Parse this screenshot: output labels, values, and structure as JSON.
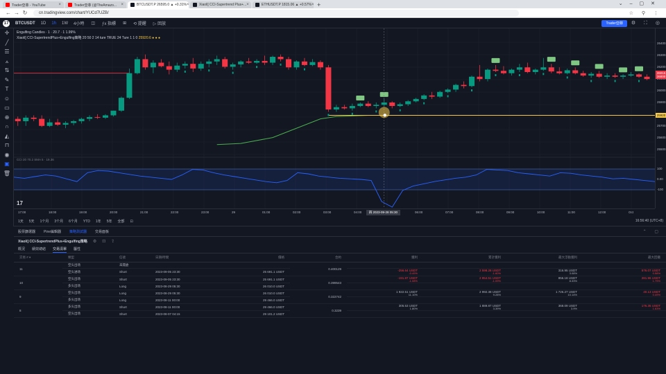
{
  "browser": {
    "tabs": [
      {
        "title": "Trader亞菲 - YouTube",
        "icon_color": "#ff0000",
        "active": false
      },
      {
        "title": "Trader亞菲 (@TheAmazo...",
        "icon_color": "#ff0000",
        "active": false
      },
      {
        "title": "BTCUSDT.P 26595.0 ▲ +0.31%",
        "icon_color": "#131722",
        "active": true
      },
      {
        "title": "Xiaoli] CCI-Supertrend Plus+...",
        "icon_color": "#131722",
        "active": false
      },
      {
        "title": "ETHUSDT.P 1815.06 ▲ +0.57%",
        "icon_color": "#131722",
        "active": false
      }
    ],
    "url": "cn.tradingview.com/chart/YUCd7UZB/"
  },
  "toolbar": {
    "logo": "17",
    "symbol": "BTCUSDT",
    "timeframes": [
      "1D",
      "1h",
      "1W",
      "4小時"
    ],
    "selected_timeframe": "1h",
    "items": [
      "◫",
      "ƒx 指標",
      "⊞",
      "⟲ 提醒",
      "▷ 回放"
    ],
    "user_button": "Trader亞菲",
    "right_icons": "⚙ ⛶ ◎"
  },
  "legend": {
    "line1": "Engulfing Candles · 1 · 20.7 · 1 1.99%",
    "line2_name": "Xiaoli] CCI-SupertrendPlus+Engulfing策略 20 50 2 14 ture TRUE 24 Ture 1 1 0",
    "line2_value": "25920.6 ● ● ●"
  },
  "price_scale": {
    "labels": [
      "26400.0",
      "26300.0",
      "26200.0",
      "26100.0",
      "26000.0",
      "25900.0",
      "25800.0",
      "25700.0",
      "25600.0",
      "25500.0"
    ],
    "tags": [
      {
        "text": "26015",
        "color": "#f23645"
      },
      {
        "text": "26000",
        "color": "#f23645"
      },
      {
        "text": "25920",
        "color": "#f7c948"
      }
    ],
    "ind_labels": [
      "100",
      "0.00",
      "-100"
    ]
  },
  "indicator_legend": "CCI 20 70.2 SMA 5 · 19.36",
  "watermark": "17",
  "time_axis": {
    "labels": [
      "17:00",
      "18:00",
      "19:00",
      "20:00",
      "21:00",
      "22:00",
      "23:00",
      "29",
      "01:00",
      "02:00",
      "03:00",
      "04:00",
      "05:00",
      "06:00",
      "07:00",
      "08:00",
      "09:00",
      "10:00",
      "11:00",
      "12:00",
      "Oct"
    ],
    "cursor_tag": "四 2023-09-28 05:30"
  },
  "range_bar": {
    "items": [
      "1天",
      "5天",
      "1个月",
      "3个月",
      "6个月",
      "YTD",
      "1年",
      "5年",
      "全部",
      "⊡"
    ],
    "clock": "16:56:40 (UTC+8)"
  },
  "tester": {
    "tabs": [
      "股票篩選器",
      "Pine編輯器",
      "策略測試器",
      "交易面板"
    ],
    "selected_tab": "策略測試器",
    "strategy_name": "Xiaoli] CCI-SupertrendPlus+Engulfing策略",
    "strategy_icons": [
      "⚙",
      "⊡",
      "⇪"
    ],
    "subtabs": [
      "概況",
      "績效總結",
      "交易清單",
      "屬性"
    ],
    "selected_subtab": "交易清單",
    "columns": [
      "交易 # ▾",
      "類型",
      "信號",
      "日期/時間",
      "價格",
      "合約",
      "獲利",
      "累計獲利",
      "最大浮動獲利",
      "最大回撤"
    ],
    "trades": [
      {
        "num": "11",
        "contracts": "0.400129",
        "rows": [
          {
            "type": "空头出场",
            "signal": "未開倉",
            "date": "",
            "price": "",
            "profit": "",
            "profit_pct": "",
            "cum": "",
            "cum_pct": "",
            "runup": "",
            "runup_pct": "",
            "dd": "",
            "dd_pct": ""
          },
          {
            "type": "空头进场",
            "signal": "Short",
            "date": "2023-09-05 23:30",
            "price": "25 691.1 USDT",
            "profit": "-256.64 USDT",
            "profit_pct": "-0.49%",
            "cum": "2 598.28 USDT",
            "cum_pct": "-1.60%",
            "runup": "316.95 USDT",
            "runup_pct": "3.08%",
            "dd": "576.07 USDT",
            "dd_pct": "0.58%"
          }
        ]
      },
      {
        "num": "10",
        "contracts": "0.399543",
        "rows": [
          {
            "type": "空头出场",
            "signal": "Short",
            "date": "2023-09-05 23:30",
            "price": "25 691.1 USDT",
            "profit": "-191.87 USDT",
            "profit_pct": "-1.08%",
            "cum": "2 854.51 USDT",
            "cum_pct": "-1.09%",
            "runup": "856.18 USDT",
            "runup_pct": "8.33%",
            "dd": "281.96 USDT",
            "dd_pct": "1.79%"
          },
          {
            "type": "多头出场",
            "signal": "Long",
            "date": "2023-08-29 05:30",
            "price": "26 010.0 USDT",
            "profit": "",
            "profit_pct": "",
            "cum": "",
            "cum_pct": "",
            "runup": "",
            "runup_pct": "",
            "dd": "",
            "dd_pct": ""
          }
        ]
      },
      {
        "num": "9",
        "contracts": "0.322742",
        "rows": [
          {
            "type": "空头出场",
            "signal": "Long",
            "date": "2023-08-29 05:30",
            "price": "26 010.0 USDT",
            "profit": "1 922.51 USDT",
            "profit_pct": "11.10%",
            "cum": "2 992.38 USDT",
            "cum_pct": "9.28%",
            "runup": "1 726.27 USDT",
            "runup_pct": "10.14%",
            "dd": "40.13 USDT",
            "dd_pct": "0.49%"
          },
          {
            "type": "多头出场",
            "signal": "Long",
            "date": "2023-08-11 00:00",
            "price": "29 466.0 USDT",
            "profit": "",
            "profit_pct": "",
            "cum": "",
            "cum_pct": "",
            "runup": "",
            "runup_pct": "",
            "dd": "",
            "dd_pct": ""
          }
        ]
      },
      {
        "num": "8",
        "contracts": "0.3239",
        "rows": [
          {
            "type": "多头出场",
            "signal": "Short",
            "date": "2023-08-11 00:00",
            "price": "29 466.0 USDT",
            "profit": "305.53 USDT",
            "profit_pct": "1.80%",
            "cum": "1 889.87 USDT",
            "cum_pct": "3.39%",
            "runup": "368.09 USDT",
            "runup_pct": "3.9%",
            "dd": "176.35 USDT",
            "dd_pct": "1.63%"
          },
          {
            "type": "空头出场",
            "signal": "Short",
            "date": "2023-08-07 04:15",
            "price": "29 101.2 USDT",
            "profit": "",
            "profit_pct": "",
            "cum": "",
            "cum_pct": "",
            "runup": "",
            "runup_pct": "",
            "dd": "",
            "dd_pct": ""
          }
        ]
      }
    ]
  },
  "colors": {
    "up": "#089981",
    "down": "#f23645",
    "supertrend": "#4caf50",
    "entry_line": "#f7c948",
    "cci": "#2962ff",
    "accent": "#2962ff"
  },
  "chart_data": {
    "type": "candlestick",
    "ylim": [
      25450,
      26450
    ],
    "candles": [
      [
        25760,
        25780,
        25700,
        25740
      ],
      [
        25740,
        25790,
        25700,
        25770
      ],
      [
        25770,
        25790,
        25740,
        25760
      ],
      [
        25760,
        25790,
        25690,
        25700
      ],
      [
        25700,
        25760,
        25690,
        25730
      ],
      [
        25730,
        25760,
        25700,
        25710
      ],
      [
        25710,
        25740,
        25680,
        25725
      ],
      [
        25725,
        25750,
        25705,
        25740
      ],
      [
        25740,
        25770,
        25720,
        25760
      ],
      [
        25760,
        25790,
        25740,
        25775
      ],
      [
        25775,
        25800,
        25760,
        25770
      ],
      [
        25770,
        25800,
        25760,
        25790
      ],
      [
        25790,
        25830,
        25780,
        25830
      ],
      [
        25830,
        25950,
        25820,
        25940
      ],
      [
        25940,
        26190,
        25930,
        26150
      ],
      [
        26150,
        26290,
        26140,
        26270
      ],
      [
        26270,
        26310,
        26180,
        26200
      ],
      [
        26200,
        26260,
        26150,
        26240
      ],
      [
        26240,
        26270,
        26200,
        26210
      ],
      [
        26210,
        26250,
        26140,
        26180
      ],
      [
        26180,
        26240,
        26160,
        26215
      ],
      [
        26215,
        26250,
        26190,
        26230
      ],
      [
        26230,
        26280,
        26160,
        26190
      ],
      [
        26190,
        26250,
        26170,
        26230
      ],
      [
        26230,
        26270,
        26200,
        26250
      ],
      [
        26250,
        26300,
        26220,
        26270
      ],
      [
        26270,
        26290,
        26190,
        26205
      ],
      [
        26205,
        26240,
        26180,
        26225
      ],
      [
        26225,
        26260,
        26200,
        26250
      ],
      [
        26250,
        26280,
        26230,
        26240
      ],
      [
        26240,
        26270,
        26230,
        26255
      ],
      [
        26255,
        26300,
        26220,
        26240
      ],
      [
        26240,
        26300,
        26220,
        26290
      ],
      [
        26290,
        26310,
        26250,
        26270
      ],
      [
        26270,
        26290,
        26180,
        26200
      ],
      [
        26200,
        26260,
        26180,
        26250
      ],
      [
        26250,
        26280,
        26210,
        26220
      ],
      [
        26220,
        26270,
        26210,
        26245
      ],
      [
        26245,
        26260,
        26180,
        26200
      ],
      [
        26200,
        26220,
        25820,
        25840
      ],
      [
        25840,
        25880,
        25820,
        25860
      ],
      [
        25860,
        25880,
        25840,
        25850
      ],
      [
        25850,
        25890,
        25830,
        25870
      ],
      [
        25870,
        25900,
        25860,
        25890
      ],
      [
        25890,
        25910,
        25860,
        25870
      ],
      [
        25870,
        25900,
        25850,
        25880
      ],
      [
        25880,
        25930,
        25870,
        25900
      ],
      [
        25900,
        25910,
        25850,
        25870
      ],
      [
        25870,
        25900,
        25860,
        25885
      ],
      [
        25885,
        25920,
        25870,
        25910
      ],
      [
        25910,
        25940,
        25900,
        25930
      ],
      [
        25930,
        25970,
        25920,
        25960
      ],
      [
        25960,
        25990,
        25930,
        25950
      ],
      [
        25950,
        26000,
        25940,
        25990
      ],
      [
        25990,
        26020,
        25980,
        26010
      ],
      [
        26010,
        26060,
        25990,
        26050
      ],
      [
        26050,
        26080,
        26020,
        26040
      ],
      [
        26040,
        26130,
        26030,
        26120
      ],
      [
        26120,
        26220,
        26080,
        26100
      ],
      [
        26100,
        26190,
        26080,
        26180
      ],
      [
        26180,
        26220,
        26160,
        26170
      ],
      [
        26170,
        26210,
        26140,
        26150
      ],
      [
        26150,
        26190,
        26130,
        26180
      ],
      [
        26180,
        26230,
        26160,
        26200
      ],
      [
        26200,
        26240,
        26150,
        26160
      ],
      [
        26160,
        26190,
        26140,
        26180
      ],
      [
        26180,
        26280,
        26170,
        26200
      ],
      [
        26200,
        26230,
        26150,
        26165
      ],
      [
        26165,
        26200,
        26140,
        26150
      ],
      [
        26150,
        26190,
        26140,
        26175
      ],
      [
        26175,
        26200,
        26140,
        26150
      ],
      [
        26150,
        26170,
        26120,
        26130
      ],
      [
        26130,
        26160,
        26110,
        26145
      ],
      [
        26145,
        26170,
        26110,
        26120
      ],
      [
        26120,
        26150,
        26100,
        26130
      ],
      [
        26130,
        26150,
        26110,
        26120
      ],
      [
        26120,
        26140,
        26100,
        26130
      ],
      [
        26130,
        26160,
        26120,
        26140
      ],
      [
        26140,
        26150,
        26110,
        26120
      ],
      [
        26120,
        26140,
        26090,
        26100
      ]
    ],
    "supertrend": [
      [
        25,
        25540
      ],
      [
        28,
        25550
      ],
      [
        32,
        25600
      ],
      [
        35,
        25680
      ],
      [
        38,
        25760
      ],
      [
        40,
        25780
      ],
      [
        44,
        25790
      ],
      [
        50,
        25790
      ],
      [
        70,
        25790
      ],
      [
        79,
        25790
      ]
    ],
    "engulf_markers_up": [
      43,
      46,
      60,
      67,
      70,
      73,
      76,
      78
    ],
    "entry_price": 25790,
    "cci": [
      20,
      10,
      25,
      40,
      30,
      5,
      -20,
      60,
      80,
      75,
      60,
      45,
      30,
      20,
      10,
      0,
      40,
      90,
      85,
      60,
      40,
      25,
      10,
      -5,
      -20,
      -30,
      -10,
      60,
      50,
      30,
      20,
      10,
      5,
      0,
      -10,
      -200,
      -250,
      -100,
      -60,
      -40,
      -20,
      -5,
      10,
      20,
      40,
      90,
      85,
      80,
      60,
      50,
      40,
      30,
      60,
      55,
      40,
      30,
      20,
      5,
      10,
      0,
      -10,
      -20
    ]
  }
}
